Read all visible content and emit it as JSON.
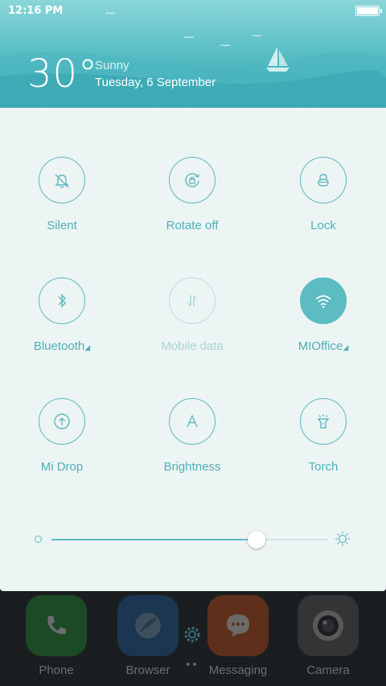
{
  "status_bar": {
    "time": "12:16 PM",
    "battery_level": 1.0
  },
  "weather": {
    "temperature": "30°",
    "condition": "Sunny",
    "date": "Tuesday, 6 September"
  },
  "tiles": [
    {
      "label": "Silent",
      "icon": "bell-off-icon",
      "state": "off"
    },
    {
      "label": "Rotate off",
      "icon": "rotate-lock-icon",
      "state": "off"
    },
    {
      "label": "Lock",
      "icon": "lock-icon",
      "state": "off"
    },
    {
      "label": "Bluetooth",
      "icon": "bluetooth-icon",
      "state": "off",
      "has_menu": true
    },
    {
      "label": "Mobile data",
      "icon": "mobile-data-icon",
      "state": "disabled"
    },
    {
      "label": "MIOffice",
      "icon": "wifi-icon",
      "state": "on",
      "has_menu": true
    },
    {
      "label": "Mi Drop",
      "icon": "mi-drop-icon",
      "state": "off"
    },
    {
      "label": "Brightness",
      "icon": "auto-brightness-icon",
      "state": "off"
    },
    {
      "label": "Torch",
      "icon": "torch-icon",
      "state": "off"
    }
  ],
  "brightness": {
    "level": 0.74
  },
  "dock": [
    {
      "label": "Phone",
      "icon": "phone-icon",
      "color": "#1d5a2a"
    },
    {
      "label": "Browser",
      "icon": "browser-icon",
      "color": "#1c3e5e"
    },
    {
      "label": "Messaging",
      "icon": "messaging-icon",
      "color": "#7a3a1d"
    },
    {
      "label": "Camera",
      "icon": "camera-icon",
      "color": "#3a3a3c"
    }
  ],
  "colors": {
    "accent": "#5cbcc2",
    "panel": "#edf4f4",
    "header": "#4db4bd"
  }
}
